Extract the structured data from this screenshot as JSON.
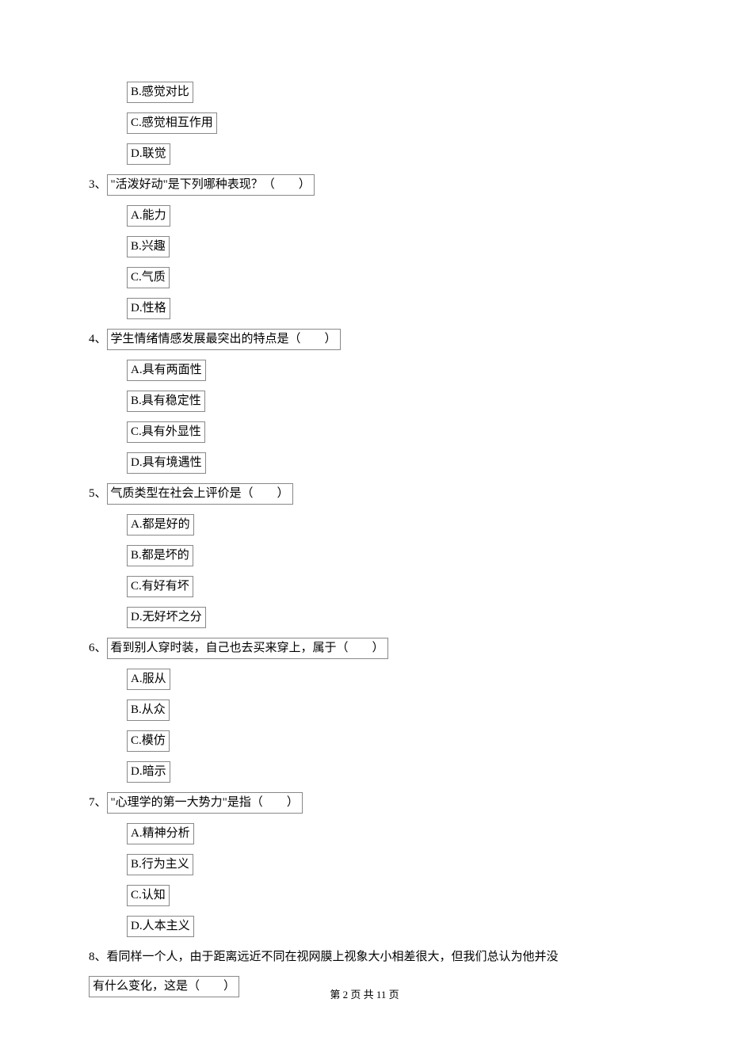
{
  "orphan_options": {
    "B": "B.感觉对比",
    "C": "C.感觉相互作用",
    "D": "D.联觉"
  },
  "questions": [
    {
      "num": "3、",
      "stem": "\"活泼好动\"是下列哪种表现？（　　）",
      "opts": {
        "A": "A.能力",
        "B": "B.兴趣",
        "C": "C.气质",
        "D": "D.性格"
      }
    },
    {
      "num": "4、",
      "stem": "学生情绪情感发展最突出的特点是（　　）",
      "opts": {
        "A": "A.具有两面性",
        "B": "B.具有稳定性",
        "C": "C.具有外显性",
        "D": "D.具有境遇性"
      }
    },
    {
      "num": "5、",
      "stem": "气质类型在社会上评价是（　　）",
      "opts": {
        "A": "A.都是好的",
        "B": "B.都是坏的",
        "C": "C.有好有坏",
        "D": "D.无好坏之分"
      }
    },
    {
      "num": "6、",
      "stem": "看到别人穿时装，自己也去买来穿上，属于（　　）",
      "opts": {
        "A": "A.服从",
        "B": "B.从众",
        "C": "C.模仿",
        "D": "D.暗示"
      }
    },
    {
      "num": "7、",
      "stem": "\"心理学的第一大势力\"是指（　　）",
      "opts": {
        "A": "A.精神分析",
        "B": "B.行为主义",
        "C": "C.认知",
        "D": "D.人本主义"
      }
    }
  ],
  "q8": {
    "num": "8、",
    "line1": "看同样一个人，由于距离远近不同在视网膜上视象大小相差很大，但我们总认为他并没",
    "line2_pre": "有什么变化，这是（　　）"
  },
  "footer": "第 2 页 共 11 页"
}
